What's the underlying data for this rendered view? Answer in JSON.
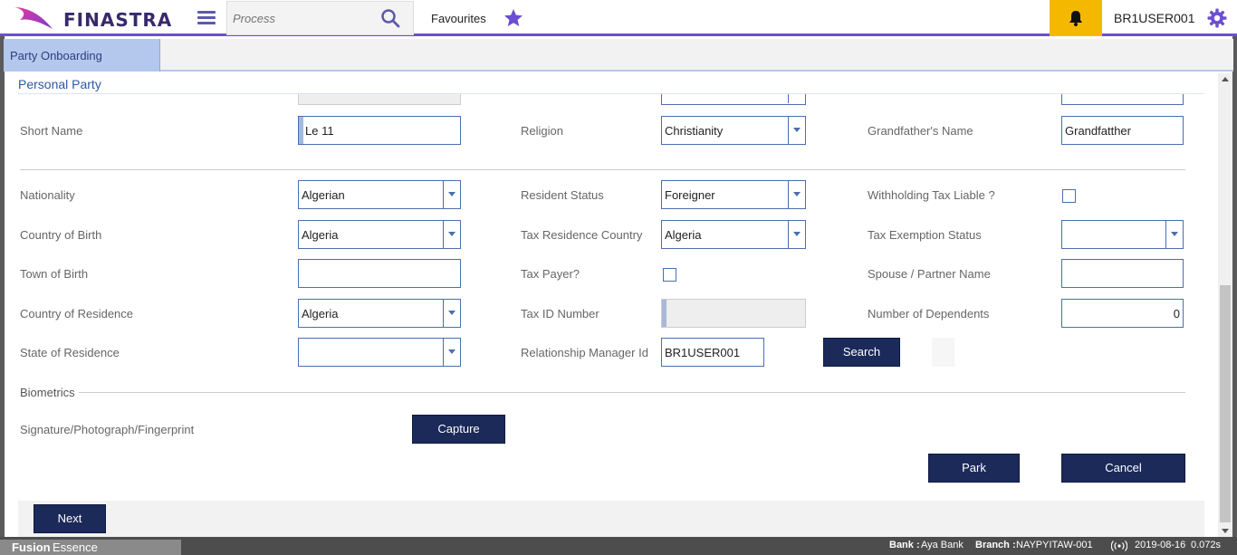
{
  "header": {
    "brand": "FINASTRA",
    "search_placeholder": "Process",
    "favourites_label": "Favourites",
    "user": "BR1USER001"
  },
  "tabs": [
    {
      "label": "Party Onboarding"
    }
  ],
  "section": {
    "title": "Personal Party"
  },
  "form": {
    "short_name": {
      "label": "Short Name",
      "value": "Le 11"
    },
    "religion": {
      "label": "Religion",
      "value": "Christianity"
    },
    "grandfathers_name": {
      "label": "Grandfather's Name",
      "value": "Grandfatther"
    },
    "nationality": {
      "label": "Nationality",
      "value": "Algerian"
    },
    "resident_status": {
      "label": "Resident Status",
      "value": "Foreigner"
    },
    "withholding_tax": {
      "label": "Withholding Tax Liable ?",
      "checked": false
    },
    "country_of_birth": {
      "label": "Country of Birth",
      "value": "Algeria"
    },
    "tax_residence_country": {
      "label": "Tax Residence Country",
      "value": "Algeria"
    },
    "tax_exemption_status": {
      "label": "Tax Exemption Status",
      "value": ""
    },
    "town_of_birth": {
      "label": "Town of Birth",
      "value": ""
    },
    "tax_payer": {
      "label": "Tax Payer?",
      "checked": false
    },
    "spouse_name": {
      "label": "Spouse / Partner Name",
      "value": ""
    },
    "country_of_residence": {
      "label": "Country of Residence",
      "value": "Algeria"
    },
    "tax_id_number": {
      "label": "Tax ID Number",
      "value": ""
    },
    "number_of_dependents": {
      "label": "Number of Dependents",
      "value": "0"
    },
    "state_of_residence": {
      "label": "State of Residence",
      "value": ""
    },
    "relationship_manager_id": {
      "label": "Relationship Manager Id",
      "value": "BR1USER001"
    }
  },
  "buttons": {
    "search": "Search",
    "capture": "Capture",
    "park": "Park",
    "cancel": "Cancel",
    "next": "Next"
  },
  "biometrics": {
    "title": "Biometrics",
    "signature_label": "Signature/Photograph/Fingerprint"
  },
  "statusbar": {
    "brand_bold": "Fusion",
    "brand_light": "Essence",
    "bank_label": "Bank :",
    "bank_value": "Aya Bank",
    "branch_label": "Branch :",
    "branch_value": "NAYPYITAW-001",
    "date": "2019-08-16",
    "timing": "0.072s"
  },
  "colors": {
    "accent": "#6b4fd1",
    "button": "#1c2a5a",
    "bell_bg": "#f5b800"
  }
}
